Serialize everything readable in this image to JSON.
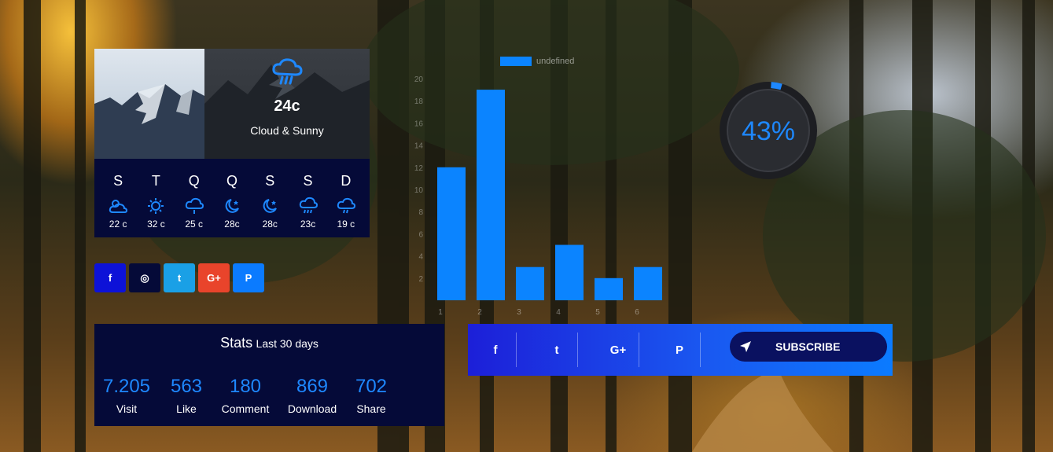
{
  "weather": {
    "current": {
      "temp": "24c",
      "condition": "Cloud & Sunny",
      "icon": "cloud-rain-icon"
    },
    "days": [
      {
        "name": "S",
        "icon": "cloud-sun-icon",
        "temp": "22 c"
      },
      {
        "name": "T",
        "icon": "sun-icon",
        "temp": "32 c"
      },
      {
        "name": "Q",
        "icon": "cloud-drizzle-icon",
        "temp": "25 c"
      },
      {
        "name": "Q",
        "icon": "moon-star-icon",
        "temp": "28c"
      },
      {
        "name": "S",
        "icon": "moon-star-icon",
        "temp": "28c"
      },
      {
        "name": "S",
        "icon": "cloud-rain-icon",
        "temp": "23c"
      },
      {
        "name": "D",
        "icon": "cloud-drizzle-icon",
        "temp": "19 c"
      }
    ]
  },
  "social_buttons": [
    {
      "name": "facebook",
      "glyph": "f",
      "color": "#0d12d8"
    },
    {
      "name": "instagram",
      "glyph": "◎",
      "color": "#050a38"
    },
    {
      "name": "twitter",
      "glyph": "t",
      "color": "#1aa0e6"
    },
    {
      "name": "google-plus",
      "glyph": "G+",
      "color": "#e9442b"
    },
    {
      "name": "pinterest",
      "glyph": "P",
      "color": "#0b7bff"
    }
  ],
  "stats": {
    "title": "Stats",
    "subtitle": "Last 30 days",
    "items": [
      {
        "value": "7.205",
        "label": "Visit"
      },
      {
        "value": "563",
        "label": "Like"
      },
      {
        "value": "180",
        "label": "Comment"
      },
      {
        "value": "869",
        "label": "Download"
      },
      {
        "value": "702",
        "label": "Share"
      }
    ]
  },
  "chart_data": {
    "type": "bar",
    "legend": "undefined",
    "categories": [
      "1",
      "2",
      "3",
      "4",
      "5",
      "6"
    ],
    "values": [
      12,
      19,
      3,
      5,
      2,
      3
    ],
    "yticks": [
      2,
      4,
      6,
      8,
      10,
      12,
      14,
      16,
      18,
      20
    ],
    "ylim": [
      0,
      20
    ],
    "color": "#0b84ff"
  },
  "gauge": {
    "value": 43,
    "label": "43%",
    "accent": "#1e88ff"
  },
  "subscribe_bar": {
    "icons": [
      {
        "name": "facebook-icon",
        "glyph": "f"
      },
      {
        "name": "twitter-icon",
        "glyph": "t"
      },
      {
        "name": "google-plus-icon",
        "glyph": "G+"
      },
      {
        "name": "pinterest-icon",
        "glyph": "P"
      }
    ],
    "button_label": "SUBSCRIBE"
  }
}
